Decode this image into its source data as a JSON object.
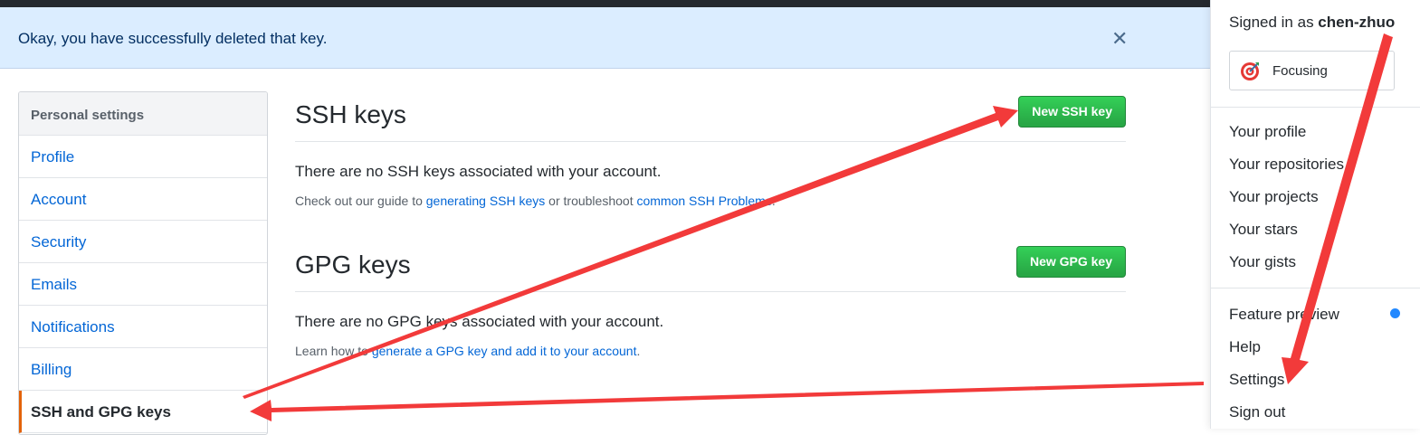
{
  "flash": {
    "message": "Okay, you have successfully deleted that key.",
    "close_glyph": "✕"
  },
  "sidebar": {
    "header": "Personal settings",
    "items": [
      {
        "label": "Profile"
      },
      {
        "label": "Account"
      },
      {
        "label": "Security"
      },
      {
        "label": "Emails"
      },
      {
        "label": "Notifications"
      },
      {
        "label": "Billing"
      },
      {
        "label": "SSH and GPG keys"
      }
    ],
    "active_accent": "#e36209"
  },
  "ssh": {
    "title": "SSH keys",
    "button": "New SSH key",
    "empty": "There are no SSH keys associated with your account.",
    "help_prefix": "Check out our guide to ",
    "help_link1": "generating SSH keys",
    "help_middle": " or troubleshoot ",
    "help_link2": "common SSH Problems",
    "help_suffix": "."
  },
  "gpg": {
    "title": "GPG keys",
    "button": "New GPG key",
    "empty": "There are no GPG keys associated with your account.",
    "help_prefix": "Learn how to ",
    "help_link": "generate a GPG key and add it to your account",
    "help_suffix": "."
  },
  "user_menu": {
    "signed_prefix": "Signed in as ",
    "username": "chen-zhuo",
    "status": "Focusing",
    "status_icon": "target-icon",
    "items_group1": [
      "Your profile",
      "Your repositories",
      "Your projects",
      "Your stars",
      "Your gists"
    ],
    "items_group2": [
      "Feature preview",
      "Help",
      "Settings",
      "Sign out"
    ]
  },
  "colors": {
    "flash_bg": "#dbedff",
    "link": "#0366d6",
    "button_green": "#28a745",
    "annotation_arrow": "#f23a3a",
    "notification_dot": "#2188ff"
  }
}
